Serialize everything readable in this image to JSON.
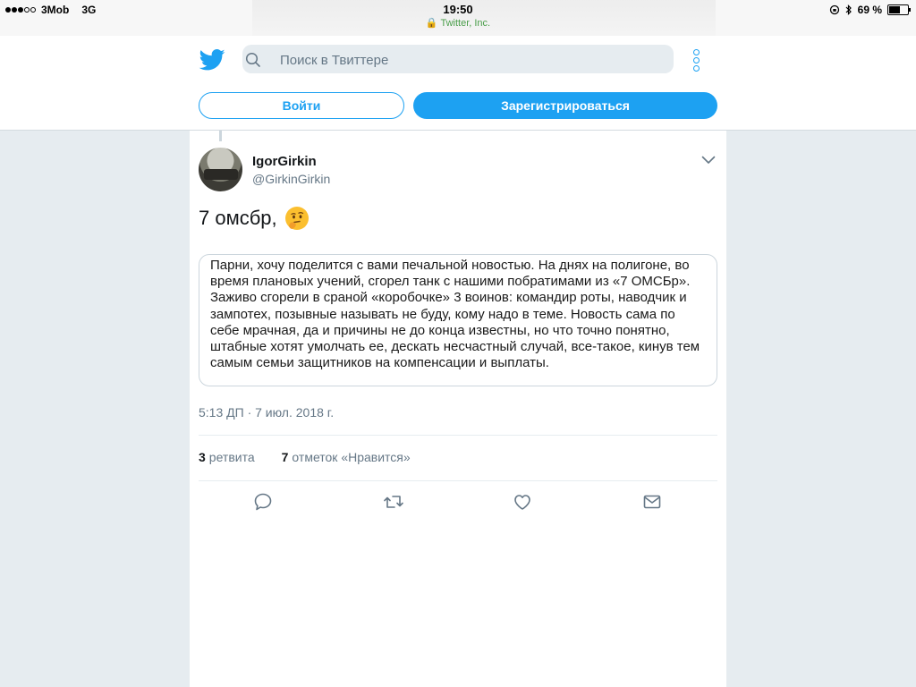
{
  "status_bar": {
    "carrier": "3Mob",
    "network": "3G",
    "time": "19:50",
    "site": "🔒 Twitter, Inc.",
    "battery": "69 %",
    "battery_level": 0.69
  },
  "header": {
    "search_placeholder": "Поиск в Твиттере",
    "login_label": "Войти",
    "signup_label": "Зарегистрироваться"
  },
  "tweet": {
    "author_name": "IgorGirkin",
    "author_handle": "@GirkinGirkin",
    "text": "7 омсбр,",
    "quote_text": "Парни, хочу поделится с вами печальной новостью. На днях на полигоне, во время плановых учений, сгорел танк с нашими побратимами из «7 ОМСБр». Заживо сгорели в сраной «коробочке» 3 воинов: командир роты, наводчик и зампотех, позывные называть не буду, кому надо в теме. Новость сама по себе мрачная, да и причины не до конца известны, но что точно понятно, штабные хотят умолчать ее, дескать несчастный случай, все-такое, кинув тем самым семьи защитников на компенсации и выплаты.",
    "timestamp": "5:13 ДП · 7 июл. 2018 г.",
    "retweets_count": "3",
    "retweets_label": "ретвита",
    "likes_count": "7",
    "likes_label": "отметок «Нравится»"
  },
  "colors": {
    "accent": "#1da1f2",
    "background": "#e6ecf0",
    "secondary_text": "#657786"
  }
}
